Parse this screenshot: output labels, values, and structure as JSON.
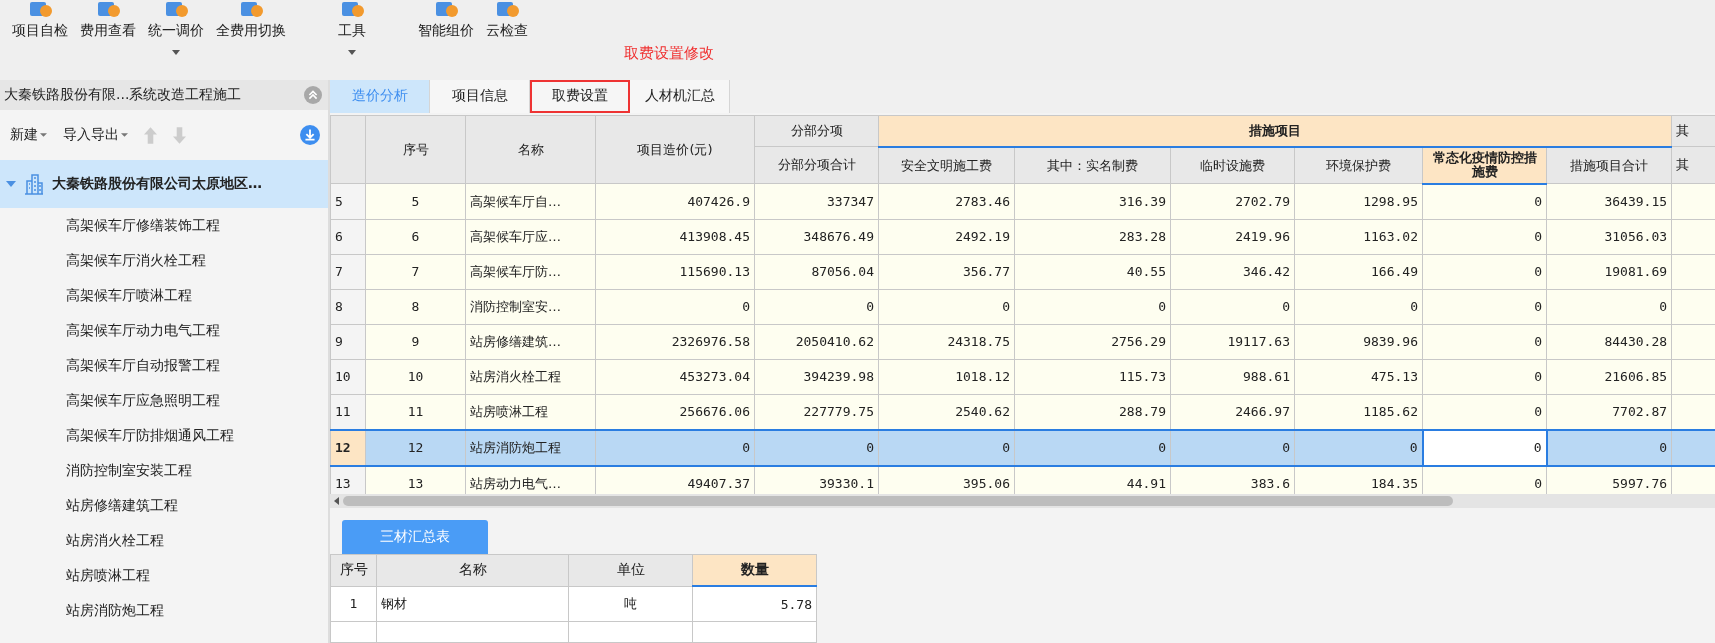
{
  "toolbar": {
    "buttons": [
      {
        "label": "项目自检",
        "dropdown": false
      },
      {
        "label": "费用查看",
        "dropdown": false
      },
      {
        "label": "统一调价",
        "dropdown": true
      },
      {
        "label": "全费用切换",
        "dropdown": false
      },
      {
        "label": "工具",
        "dropdown": true
      },
      {
        "label": "智能组价",
        "dropdown": false
      },
      {
        "label": "云检查",
        "dropdown": false
      }
    ]
  },
  "annotation": {
    "label": "取费设置修改"
  },
  "project_panel": {
    "title": "大秦铁路股份有限...系统改造工程施工",
    "new_label": "新建",
    "import_export_label": "导入导出",
    "tree": {
      "label": "大秦铁路股份有限公司太原地区…",
      "expanded": true,
      "selected": true,
      "children": [
        {
          "label": "高架候车厅修缮装饰工程"
        },
        {
          "label": "高架候车厅消火栓工程"
        },
        {
          "label": "高架候车厅喷淋工程"
        },
        {
          "label": "高架候车厅动力电气工程"
        },
        {
          "label": "高架候车厅自动报警工程"
        },
        {
          "label": "高架候车厅应急照明工程"
        },
        {
          "label": "高架候车厅防排烟通风工程"
        },
        {
          "label": "消防控制室安装工程"
        },
        {
          "label": "站房修缮建筑工程"
        },
        {
          "label": "站房消火栓工程"
        },
        {
          "label": "站房喷淋工程"
        },
        {
          "label": "站房消防炮工程"
        }
      ]
    }
  },
  "tabs": [
    {
      "label": "造价分析",
      "selected": true,
      "annotated": false
    },
    {
      "label": "项目信息",
      "selected": false,
      "annotated": false
    },
    {
      "label": "取费设置",
      "selected": false,
      "annotated": true
    },
    {
      "label": "人材机汇总",
      "selected": false,
      "annotated": false
    }
  ],
  "table": {
    "header": [
      {
        "kind": "single",
        "label": "序号",
        "selected": false
      },
      {
        "kind": "single",
        "label": "名称",
        "selected": false
      },
      {
        "kind": "single",
        "label": "项目造价(元)",
        "selected": false
      },
      {
        "kind": "group",
        "label": "分部分项",
        "selected": false,
        "columns": [
          {
            "label": "分部分项合计",
            "selected": false
          }
        ]
      },
      {
        "kind": "group",
        "label": "措施项目",
        "selected": true,
        "columns": [
          {
            "label": "安全文明施工费",
            "selected": false
          },
          {
            "label": "其中：实名制费",
            "selected": false
          },
          {
            "label": "临时设施费",
            "selected": false
          },
          {
            "label": "环境保护费",
            "selected": false
          },
          {
            "label": "常态化疫情防控措施费",
            "selected": true
          },
          {
            "label": "措施项目合计",
            "selected": false
          }
        ]
      },
      {
        "kind": "group",
        "label": "其",
        "selected": false,
        "columns": [
          {
            "label": "其",
            "selected": false
          }
        ]
      }
    ],
    "rows": [
      {
        "number": "5",
        "selected": false,
        "cells": [
          "5",
          "高架候车厅自…",
          "407426.9",
          "337347",
          "2783.46",
          "316.39",
          "2702.79",
          "1298.95",
          "0",
          "36439.15",
          ""
        ]
      },
      {
        "number": "6",
        "selected": false,
        "cells": [
          "6",
          "高架候车厅应…",
          "413908.45",
          "348676.49",
          "2492.19",
          "283.28",
          "2419.96",
          "1163.02",
          "0",
          "31056.03",
          ""
        ]
      },
      {
        "number": "7",
        "selected": false,
        "cells": [
          "7",
          "高架候车厅防…",
          "115690.13",
          "87056.04",
          "356.77",
          "40.55",
          "346.42",
          "166.49",
          "0",
          "19081.69",
          ""
        ]
      },
      {
        "number": "8",
        "selected": false,
        "cells": [
          "8",
          "消防控制室安…",
          "0",
          "0",
          "0",
          "0",
          "0",
          "0",
          "0",
          "0",
          ""
        ]
      },
      {
        "number": "9",
        "selected": false,
        "cells": [
          "9",
          "站房修缮建筑…",
          "2326976.58",
          "2050410.62",
          "24318.75",
          "2756.29",
          "19117.63",
          "9839.96",
          "0",
          "84430.28",
          ""
        ]
      },
      {
        "number": "10",
        "selected": false,
        "cells": [
          "10",
          "站房消火栓工程",
          "453273.04",
          "394239.98",
          "1018.12",
          "115.73",
          "988.61",
          "475.13",
          "0",
          "21606.85",
          ""
        ]
      },
      {
        "number": "11",
        "selected": false,
        "cells": [
          "11",
          "站房喷淋工程",
          "256676.06",
          "227779.75",
          "2540.62",
          "288.79",
          "2466.97",
          "1185.62",
          "0",
          "7702.87",
          ""
        ]
      },
      {
        "number": "12",
        "selected": true,
        "cells": [
          "12",
          "站房消防炮工程",
          "0",
          "0",
          "0",
          "0",
          "0",
          "0",
          "0",
          "0",
          ""
        ]
      },
      {
        "number": "13",
        "selected": false,
        "cells": [
          "13",
          "站房动力电气…",
          "49407.37",
          "39330.1",
          "395.06",
          "44.91",
          "383.6",
          "184.35",
          "0",
          "5997.76",
          ""
        ]
      }
    ]
  },
  "materials": {
    "tab": {
      "label": "三材汇总表",
      "selected": true
    },
    "columns": [
      {
        "label": "序号",
        "kind": "index",
        "selected": false
      },
      {
        "label": "名称",
        "kind": "text",
        "selected": false
      },
      {
        "label": "单位",
        "kind": "index",
        "selected": false
      },
      {
        "label": "数量",
        "kind": "number",
        "selected": true
      }
    ],
    "rows": [
      {
        "cells": [
          "1",
          "钢材",
          "吨",
          "5.78"
        ]
      }
    ]
  }
}
